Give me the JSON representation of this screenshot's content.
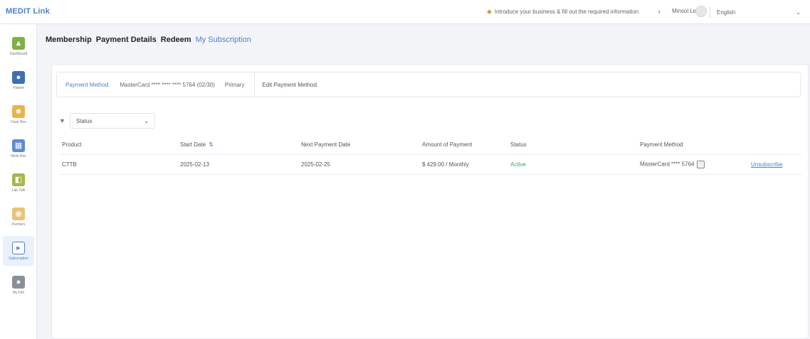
{
  "app": {
    "logo_text": "MEDIT Link"
  },
  "topbar": {
    "notice_text": "Introduce your business & fill out the required information",
    "user_name": "Minsol Lee",
    "language": "English"
  },
  "sidebar": {
    "items": [
      {
        "label": "Dashboard",
        "icon": "dashboard-icon",
        "color": "#7cb342"
      },
      {
        "label": "Patient",
        "icon": "patient-icon",
        "color": "#3f6fb5"
      },
      {
        "label": "Case Box",
        "icon": "case-box-icon",
        "color": "#e9b44c"
      },
      {
        "label": "Work Box",
        "icon": "work-box-icon",
        "color": "#5c8bd6"
      },
      {
        "label": "Lab Talk",
        "icon": "lab-talk-icon",
        "color": "#a3b84a"
      },
      {
        "label": "Partners",
        "icon": "partners-icon",
        "color": "#e8c27a"
      },
      {
        "label": "Subscription",
        "icon": "subscription-icon",
        "color": "#4f7fcf"
      },
      {
        "label": "My Info",
        "icon": "my-info-icon",
        "color": "#8a8f99"
      }
    ],
    "active_index": 6
  },
  "tabs": [
    "Membership",
    "Payment Details",
    "Redeem",
    "My Subscription"
  ],
  "active_tab": "My Subscription",
  "payment_card": {
    "label": "Payment Method",
    "value": "MasterCard **** **** **** 5764 (02/30)",
    "status": "Primary",
    "edit_label": "Edit Payment Method"
  },
  "filter": {
    "value": "Status"
  },
  "table": {
    "headers": [
      "Product",
      "Start Date",
      "Next Payment Date",
      "Amount of Payment",
      "Status",
      "Payment Method",
      ""
    ],
    "rows": [
      {
        "product": "CTTB",
        "start_date": "2025-02-13",
        "next_payment_date": "2025-02-25",
        "amount": "$ 429.00 / Monthly",
        "status": "Active",
        "payment_method": "MasterCard **** 5764",
        "action": "Unsubscribe"
      }
    ]
  },
  "colors": {
    "accent": "#4f7fcf",
    "active_status": "#3aa46a"
  }
}
